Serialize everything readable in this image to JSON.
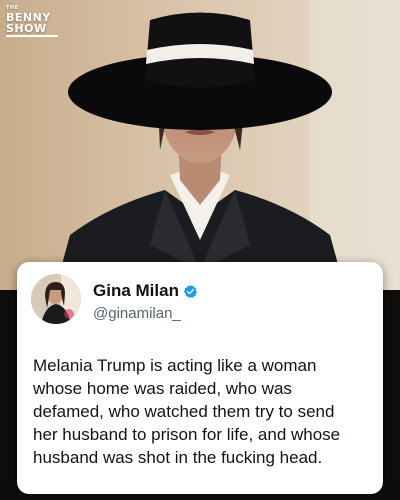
{
  "logo": {
    "small": "THE",
    "line1": "BENNY",
    "line2": "SHOW"
  },
  "photo": {
    "subject": "portrait-with-wide-brim-hat"
  },
  "tweet": {
    "author_name": "Gina Milan",
    "handle": "@ginamilan_",
    "verified": true,
    "text": "Melania Trump is acting like a woman\nwhose home was raided, who was\ndefamed, who watched them try to send\nher husband to prison for life, and whose\nhusband was shot in the fucking head."
  },
  "colors": {
    "verified": "#1d9bf0",
    "handle": "#536471",
    "text": "#0f1419",
    "card": "#ffffff"
  }
}
